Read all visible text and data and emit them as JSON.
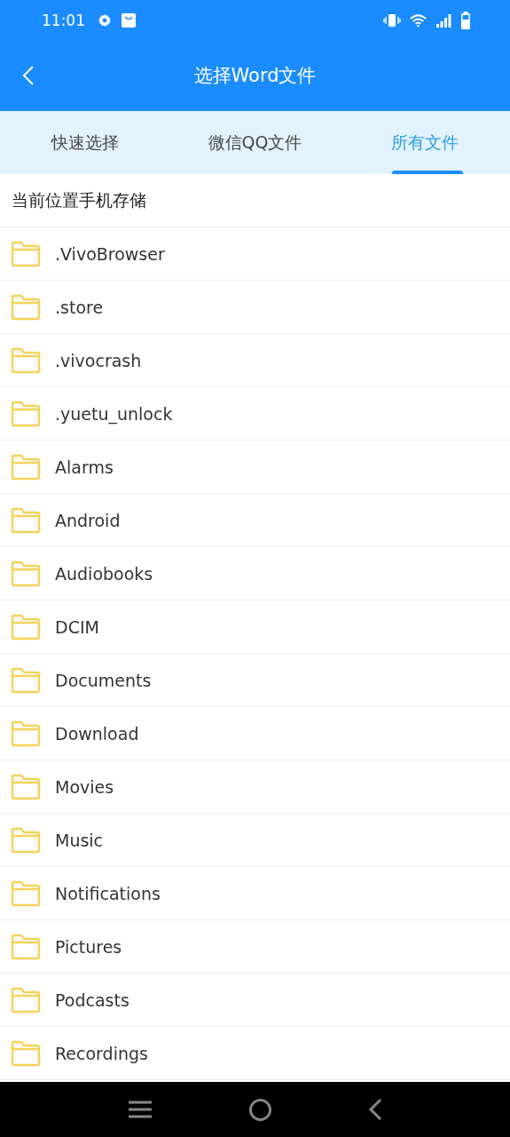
{
  "status_bar": {
    "time": "11:01"
  },
  "app_bar": {
    "title": "选择Word文件"
  },
  "tabs": [
    {
      "label": "快速选择",
      "selected": false
    },
    {
      "label": "微信QQ文件",
      "selected": false
    },
    {
      "label": "所有文件",
      "selected": true
    }
  ],
  "location": "当前位置手机存储",
  "folders": [
    {
      "name": ".VivoBrowser"
    },
    {
      "name": ".store"
    },
    {
      "name": ".vivocrash"
    },
    {
      "name": ".yuetu_unlock"
    },
    {
      "name": "Alarms"
    },
    {
      "name": "Android"
    },
    {
      "name": "Audiobooks"
    },
    {
      "name": "DCIM"
    },
    {
      "name": "Documents"
    },
    {
      "name": "Download"
    },
    {
      "name": "Movies"
    },
    {
      "name": "Music"
    },
    {
      "name": "Notifications"
    },
    {
      "name": "Pictures"
    },
    {
      "name": "Podcasts"
    },
    {
      "name": "Recordings"
    }
  ]
}
